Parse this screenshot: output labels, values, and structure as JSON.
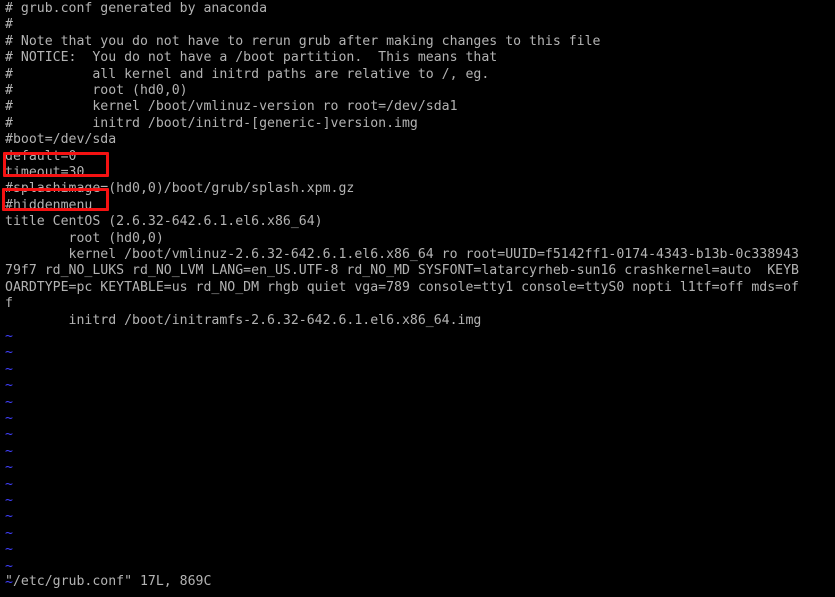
{
  "terminal": {
    "background_color": "#000000",
    "foreground_color": "#b3b3b3",
    "nontext_color": "#4040ff",
    "annotation_color": "#f51212",
    "editor": "vim",
    "lines": [
      "# grub.conf generated by anaconda",
      "#",
      "# Note that you do not have to rerun grub after making changes to this file",
      "# NOTICE:  You do not have a /boot partition.  This means that",
      "#          all kernel and initrd paths are relative to /, eg.",
      "#          root (hd0,0)",
      "#          kernel /boot/vmlinuz-version ro root=/dev/sda1",
      "#          initrd /boot/initrd-[generic-]version.img",
      "#boot=/dev/sda",
      "default=0",
      "timeout=30",
      "#splashimage=(hd0,0)/boot/grub/splash.xpm.gz",
      "#hiddenmenu",
      "title CentOS (2.6.32-642.6.1.el6.x86_64)",
      "        root (hd0,0)",
      "        kernel /boot/vmlinuz-2.6.32-642.6.1.el6.x86_64 ro root=UUID=f5142ff1-0174-4343-b13b-0c338943",
      "79f7 rd_NO_LUKS rd_NO_LVM LANG=en_US.UTF-8 rd_NO_MD SYSFONT=latarcyrheb-sun16 crashkernel=auto  KEYB",
      "OARDTYPE=pc KEYTABLE=us rd_NO_DM rhgb quiet vga=789 console=tty1 console=ttyS0 nopti l1tf=off mds=of",
      "f",
      "        initrd /boot/initramfs-2.6.32-642.6.1.el6.x86_64.img"
    ],
    "empty_line_marker": "~",
    "empty_line_count": 16,
    "status_line": "\"/etc/grub.conf\" 17L, 869C"
  },
  "annotations": [
    {
      "label": "timeout-highlight",
      "target_text": "timeout=30"
    },
    {
      "label": "hiddenmenu-highlight",
      "target_text": "#hiddenmenu"
    }
  ]
}
